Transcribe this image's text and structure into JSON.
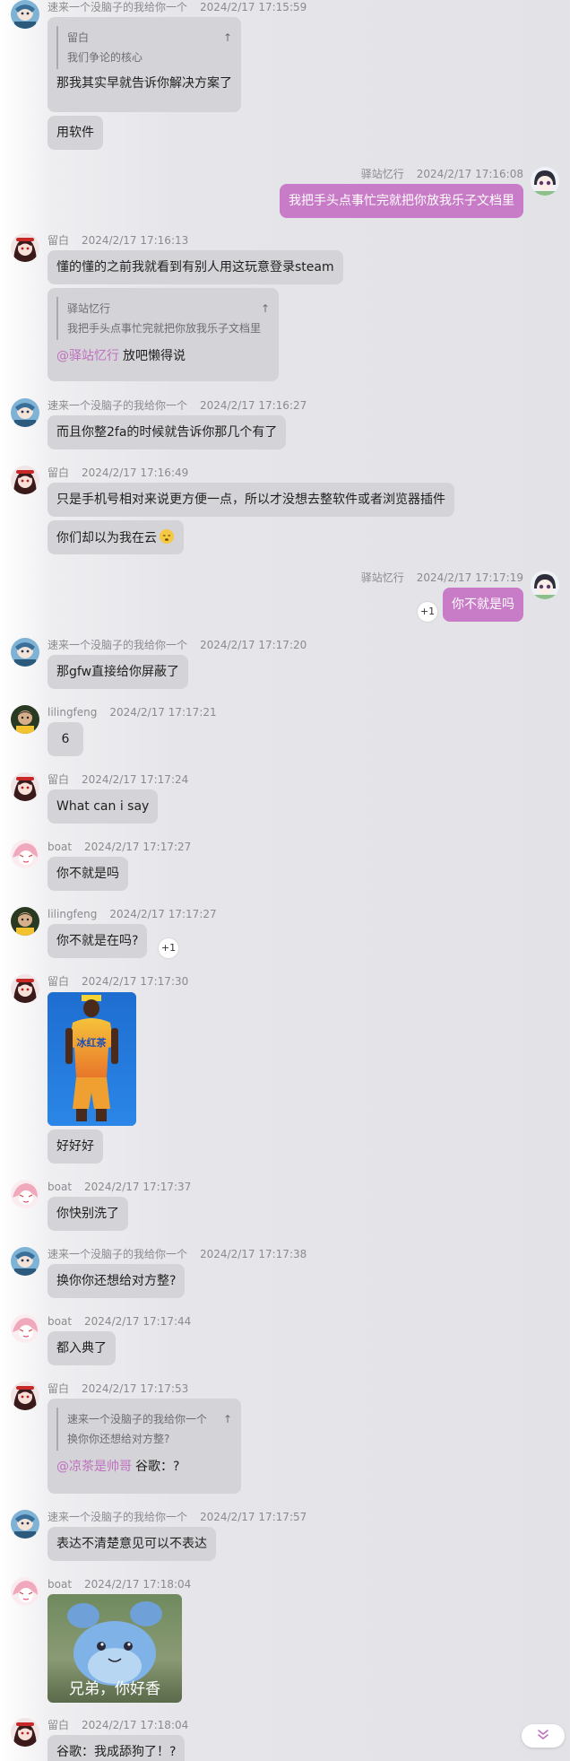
{
  "users": {
    "sulai": "速来一个没脑子的我给你一个",
    "liubai": "留白",
    "yizhan": "驿站忆行",
    "lilingfeng": "lilingfeng",
    "boat": "boat"
  },
  "messages": [
    {
      "nick": "速来一个没脑子的我给你一个",
      "time": "2024/2/17 17:15:59",
      "quote_nick": "留白",
      "quote_arrow": "↑",
      "quote_text": "我们争论的核心",
      "text1": "那我其实早就告诉你解决方案了",
      "text2": "用软件"
    },
    {
      "nick": "驿站忆行",
      "time": "2024/2/17 17:16:08",
      "text": "我把手头点事忙完就把你放我乐子文档里"
    },
    {
      "nick": "留白",
      "time": "2024/2/17 17:16:13",
      "text": "懂的懂的之前我就看到有别人用这玩意登录steam",
      "quote_nick": "驿站忆行",
      "quote_arrow": "↑",
      "quote_text": "我把手头点事忙完就把你放我乐子文档里",
      "mention": "@驿站忆行",
      "reply": "放吧懒得说"
    },
    {
      "nick": "速来一个没脑子的我给你一个",
      "time": "2024/2/17 17:16:27",
      "text": "而且你整2fa的时候就告诉你那几个有了"
    },
    {
      "nick": "留白",
      "time": "2024/2/17 17:16:49",
      "text1": "只是手机号相对来说更方便一点，所以才没想去整软件或者浏览器插件",
      "text2": "你们却以为我在云"
    },
    {
      "nick": "驿站忆行",
      "time": "2024/2/17 17:17:19",
      "text": "你不就是吗",
      "plus": "+1"
    },
    {
      "nick": "速来一个没脑子的我给你一个",
      "time": "2024/2/17 17:17:20",
      "text": "那gfw直接给你屏蔽了"
    },
    {
      "nick": "lilingfeng",
      "time": "2024/2/17 17:17:21",
      "text": "6"
    },
    {
      "nick": "留白",
      "time": "2024/2/17 17:17:24",
      "text": "What can i say"
    },
    {
      "nick": "boat",
      "time": "2024/2/17 17:17:27",
      "text": "你不就是吗"
    },
    {
      "nick": "lilingfeng",
      "time": "2024/2/17 17:17:27",
      "text": "你不就是在吗?",
      "plus": "+1"
    },
    {
      "nick": "留白",
      "time": "2024/2/17 17:17:30",
      "image_text": "冰红茶",
      "text": "好好好"
    },
    {
      "nick": "boat",
      "time": "2024/2/17 17:17:37",
      "text": "你快别洗了"
    },
    {
      "nick": "速来一个没脑子的我给你一个",
      "time": "2024/2/17 17:17:38",
      "text": "换你你还想给对方整?"
    },
    {
      "nick": "boat",
      "time": "2024/2/17 17:17:44",
      "text": "都入典了"
    },
    {
      "nick": "留白",
      "time": "2024/2/17 17:17:53",
      "quote_nick": "速来一个没脑子的我给你一个",
      "quote_arrow": "↑",
      "quote_text": "换你你还想给对方整?",
      "mention": "@凉茶是帅哥",
      "reply": "谷歌：?"
    },
    {
      "nick": "速来一个没脑子的我给你一个",
      "time": "2024/2/17 17:17:57",
      "text": "表达不清楚意见可以不表达"
    },
    {
      "nick": "boat",
      "time": "2024/2/17 17:18:04",
      "image_caption": "兄弟，你好香"
    },
    {
      "nick": "留白",
      "time": "2024/2/17 17:18:04",
      "text": "谷歌：我成舔狗了！?"
    }
  ],
  "colors": {
    "self_bubble": "#c87bc6",
    "bubble": "#d4d4d8",
    "mention": "#c06fbf"
  },
  "scroll_icon": "double-chevron-down-icon"
}
